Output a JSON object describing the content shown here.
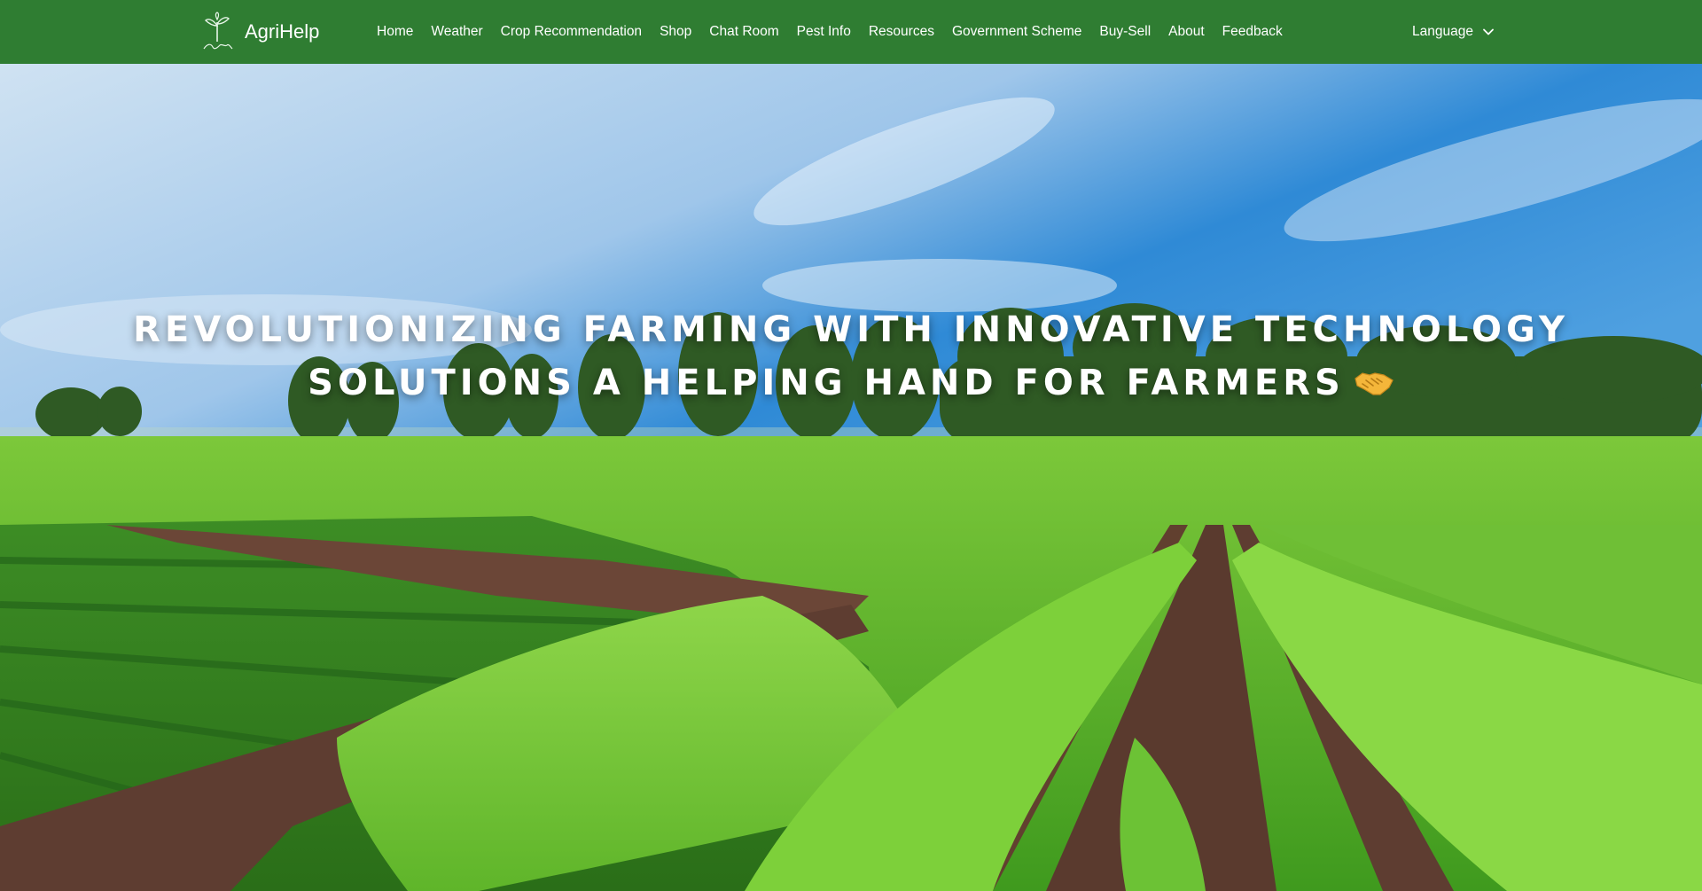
{
  "brand": {
    "name": "AgriHelp",
    "logo_icon": "sprout-logo-icon"
  },
  "nav": {
    "items": [
      {
        "label": "Home"
      },
      {
        "label": "Weather"
      },
      {
        "label": "Crop Recommendation"
      },
      {
        "label": "Shop"
      },
      {
        "label": "Chat Room"
      },
      {
        "label": "Pest Info"
      },
      {
        "label": "Resources"
      },
      {
        "label": "Government Scheme"
      },
      {
        "label": "Buy-Sell"
      },
      {
        "label": "About"
      },
      {
        "label": "Feedback"
      }
    ],
    "language_label": "Language"
  },
  "hero": {
    "headline_line1": "REVOLUTIONIZING FARMING WITH INNOVATIVE TECHNOLOGY",
    "headline_line2": "SOLUTIONS A HELPING HAND FOR FARMERS",
    "emoji_icon": "handshake-icon"
  },
  "colors": {
    "navbar": "#2f7d32",
    "text": "#ffffff",
    "sky_top": "#1f7fd0",
    "field_green": "#6cbf2a",
    "soil": "#5a3a2e"
  }
}
